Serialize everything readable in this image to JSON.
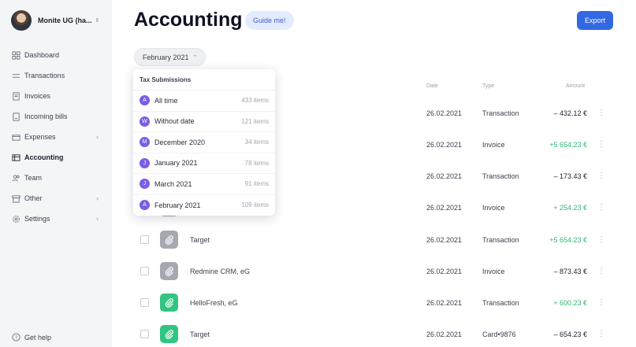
{
  "org": {
    "name": "Monite UG (ha...",
    "chevron": "⌃⌄"
  },
  "sidebar": {
    "items": [
      {
        "label": "Dashboard",
        "icon": "dashboard-icon"
      },
      {
        "label": "Transactions",
        "icon": "transactions-icon"
      },
      {
        "label": "Invoices",
        "icon": "invoices-icon"
      },
      {
        "label": "Incoming bills",
        "icon": "bills-icon"
      },
      {
        "label": "Expenses",
        "icon": "expenses-icon",
        "arrow": "›"
      },
      {
        "label": "Accounting",
        "icon": "accounting-icon",
        "active": true
      },
      {
        "label": "Team",
        "icon": "team-icon"
      },
      {
        "label": "Other",
        "icon": "other-icon",
        "arrow": "›"
      },
      {
        "label": "Settings",
        "icon": "settings-icon",
        "arrow": "›"
      }
    ],
    "help": "Get help"
  },
  "header": {
    "title": "Accounting",
    "guide_label": "Guide me!",
    "export_label": "Export"
  },
  "filter": {
    "label": "February 2021",
    "chevron": "⌃"
  },
  "table": {
    "headers": {
      "date": "Date",
      "type": "Type",
      "amount": "Amount"
    },
    "rows": [
      {
        "name": "",
        "date": "26.02.2021",
        "type": "Transaction",
        "amount": "– 432.12 €",
        "positive": false,
        "icon": "grey"
      },
      {
        "name": "",
        "date": "26.02.2021",
        "type": "Invoice",
        "amount": "+5 654.23 €",
        "positive": true,
        "icon": "grey"
      },
      {
        "name": "",
        "date": "26.02.2021",
        "type": "Transaction",
        "amount": "– 173.43 €",
        "positive": false,
        "icon": "grey"
      },
      {
        "name": "",
        "date": "26.02.2021",
        "type": "Invoice",
        "amount": "+ 254.23 €",
        "positive": true,
        "icon": "grey"
      },
      {
        "name": "Target",
        "date": "26.02.2021",
        "type": "Transaction",
        "amount": "+5 654.23 €",
        "positive": true,
        "icon": "grey"
      },
      {
        "name": "Redmine CRM, eG",
        "date": "26.02.2021",
        "type": "Invoice",
        "amount": "– 873.43 €",
        "positive": false,
        "icon": "grey"
      },
      {
        "name": "HelloFresh, eG",
        "date": "26.02.2021",
        "type": "Transaction",
        "amount": "+ 600.23 €",
        "positive": true,
        "icon": "green"
      },
      {
        "name": "Target",
        "date": "26.02.2021",
        "type": "Card•9876",
        "amount": "– 654.23 €",
        "positive": false,
        "icon": "green"
      }
    ],
    "more_glyph": "⋮"
  },
  "dropdown": {
    "title": "Tax Submissions",
    "items": [
      {
        "badge": "A",
        "label": "All time",
        "count": "433 items"
      },
      {
        "badge": "W",
        "label": "Without date",
        "count": "121 items"
      },
      {
        "badge": "M",
        "label": "December 2020",
        "count": "34 items"
      },
      {
        "badge": "J",
        "label": "January 2021",
        "count": "78 items"
      },
      {
        "badge": "J",
        "label": "March 2021",
        "count": "91 items"
      },
      {
        "badge": "A",
        "label": "February 2021",
        "count": "109 items"
      }
    ]
  },
  "colors": {
    "accent": "#3269e3",
    "badge": "#7b5de6",
    "positive": "#2eb872",
    "sidebar_bg": "#f4f5f7"
  }
}
